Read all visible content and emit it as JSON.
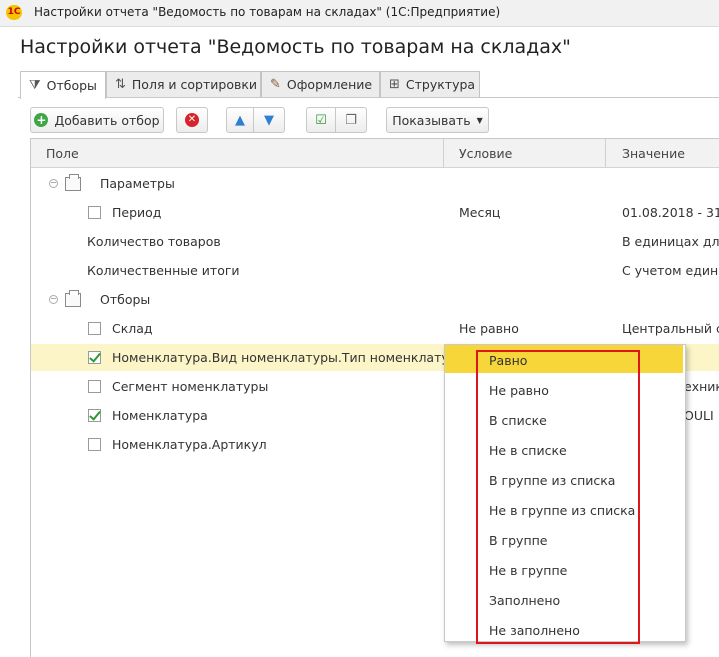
{
  "window": {
    "title": "Настройки отчета \"Ведомость по товарам на складах\"  (1С:Предприятие)",
    "logo": "1С"
  },
  "page_title": "Настройки отчета \"Ведомость по товарам на складах\"",
  "tabs": [
    {
      "label": "Отборы",
      "icon": "filter-icon",
      "active": true
    },
    {
      "label": "Поля и сортировки",
      "icon": "sort-icon"
    },
    {
      "label": "Оформление",
      "icon": "brush-icon"
    },
    {
      "label": "Структура",
      "icon": "structure-icon"
    }
  ],
  "toolbar": {
    "add_label": "Добавить отбор",
    "show_label": "Показывать"
  },
  "table": {
    "columns": [
      "Поле",
      "Условие",
      "Значение"
    ],
    "rows": [
      {
        "field": "Параметры",
        "condition": "",
        "value": ""
      },
      {
        "field": "Период",
        "condition": "Месяц",
        "value": "01.08.2018 - 31.0",
        "checked": false
      },
      {
        "field": "Количество товаров",
        "condition": "",
        "value": "В единицах для"
      },
      {
        "field": "Количественные итоги",
        "condition": "",
        "value": "С учетом едини"
      },
      {
        "field": "Отборы",
        "condition": "",
        "value": ""
      },
      {
        "field": "Склад",
        "condition": "Не равно",
        "value": "Центральный ск",
        "checked": false
      },
      {
        "field": "Номенклатура.Вид номенклатуры.Тип номенклатуры",
        "condition": "",
        "value": "",
        "checked": true
      },
      {
        "field": "Сегмент номенклатуры",
        "condition": "",
        "value": "ехника",
        "checked": false
      },
      {
        "field": "Номенклатура",
        "condition": "",
        "value": "OULI",
        "checked": true
      },
      {
        "field": "Номенклатура.Артикул",
        "condition": "",
        "value": "",
        "checked": false
      }
    ]
  },
  "dropdown": {
    "selected_index": 0,
    "items": [
      "Равно",
      "Не равно",
      "В списке",
      "Не в списке",
      "В группе из списка",
      "Не в группе из списка",
      "В группе",
      "Не в группе",
      "Заполнено",
      "Не заполнено"
    ]
  },
  "colors": {
    "highlight_row": "#fbf5c8",
    "selected_item": "#f7d63a",
    "annotation_frame": "#e0141e"
  }
}
